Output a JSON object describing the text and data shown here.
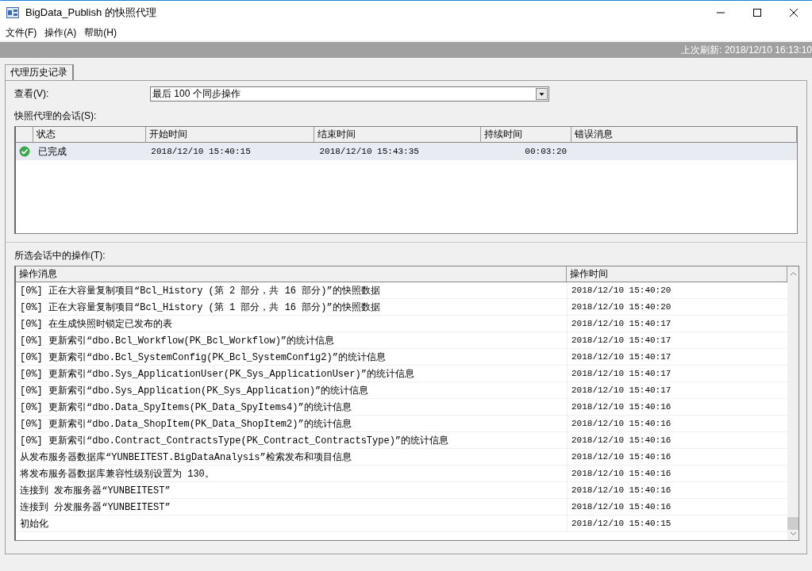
{
  "window": {
    "title": "BigData_Publish 的快照代理"
  },
  "menu": [
    "文件(F)",
    "操作(A)",
    "帮助(H)"
  ],
  "refresh_bar": {
    "text": "上次刷新: 2018/12/10 16:13:10"
  },
  "tabs": [
    {
      "label": "代理历史记录",
      "selected": true
    }
  ],
  "view": {
    "label": "查看(V):",
    "value": "最后 100 个同步操作"
  },
  "sessions": {
    "label": "快照代理的会话(S):",
    "columns": [
      "状态",
      "开始时间",
      "结束时间",
      "持续时间",
      "错误消息"
    ],
    "rows": [
      {
        "status": "已完成",
        "start": "2018/12/10 15:40:15",
        "end": "2018/12/10 15:43:35",
        "duration": "00:03:20",
        "error": "",
        "selected": true
      }
    ]
  },
  "operations": {
    "label": "所选会话中的操作(T):",
    "columns": [
      "操作消息",
      "操作时间"
    ],
    "rows": [
      {
        "message": "[0%] 正在大容量复制项目“Bcl_History (第 2 部分，共 16 部分)”的快照数据",
        "time": "2018/12/10 15:40:20"
      },
      {
        "message": "[0%] 正在大容量复制项目“Bcl_History (第 1 部分，共 16 部分)”的快照数据",
        "time": "2018/12/10 15:40:20"
      },
      {
        "message": "[0%] 在生成快照时锁定已发布的表",
        "time": "2018/12/10 15:40:17"
      },
      {
        "message": "[0%] 更新索引“dbo.Bcl_Workflow(PK_Bcl_Workflow)”的统计信息",
        "time": "2018/12/10 15:40:17"
      },
      {
        "message": "[0%] 更新索引“dbo.Bcl_SystemConfig(PK_Bcl_SystemConfig2)”的统计信息",
        "time": "2018/12/10 15:40:17"
      },
      {
        "message": "[0%] 更新索引“dbo.Sys_ApplicationUser(PK_Sys_ApplicationUser)”的统计信息",
        "time": "2018/12/10 15:40:17"
      },
      {
        "message": "[0%] 更新索引“dbo.Sys_Application(PK_Sys_Application)”的统计信息",
        "time": "2018/12/10 15:40:17"
      },
      {
        "message": "[0%] 更新索引“dbo.Data_SpyItems(PK_Data_SpyItems4)”的统计信息",
        "time": "2018/12/10 15:40:16"
      },
      {
        "message": "[0%] 更新索引“dbo.Data_ShopItem(PK_Data_ShopItem2)”的统计信息",
        "time": "2018/12/10 15:40:16"
      },
      {
        "message": "[0%] 更新索引“dbo.Contract_ContractsType(PK_Contract_ContractsType)”的统计信息",
        "time": "2018/12/10 15:40:16"
      },
      {
        "message": "从发布服务器数据库“YUNBEITEST.BigDataAnalysis”检索发布和项目信息",
        "time": "2018/12/10 15:40:16"
      },
      {
        "message": "将发布服务器数据库兼容性级别设置为 130。",
        "time": "2018/12/10 15:40:16"
      },
      {
        "message": "连接到 发布服务器“YUNBEITEST”",
        "time": "2018/12/10 15:40:16"
      },
      {
        "message": "连接到 分发服务器“YUNBEITEST”",
        "time": "2018/12/10 15:40:16"
      },
      {
        "message": "初始化",
        "time": "2018/12/10 15:40:15"
      }
    ]
  }
}
